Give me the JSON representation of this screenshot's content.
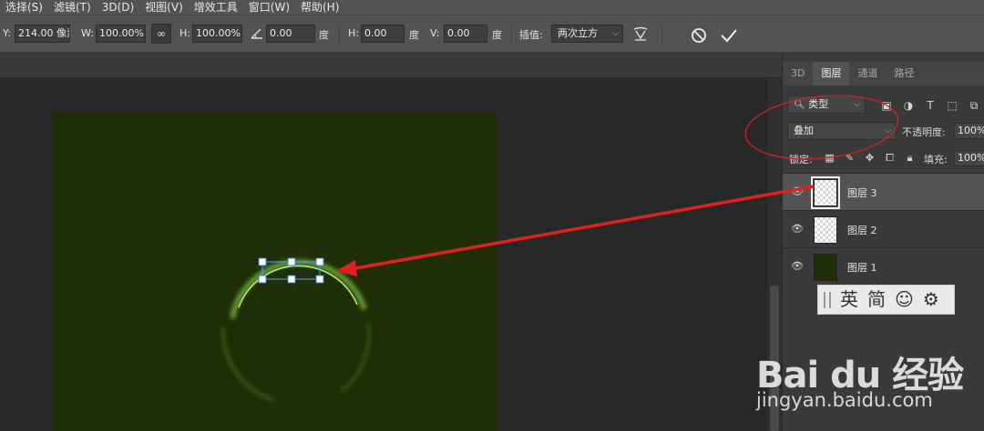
{
  "menu": [
    "选择(S)",
    "滤镜(T)",
    "3D(D)",
    "视图(V)",
    "增效工具",
    "窗口(W)",
    "帮助(H)"
  ],
  "options": {
    "y_label": "Y:",
    "y_value": "214.00 像素",
    "w_label": "W:",
    "w_value": "100.00%",
    "link_glyph": "∞",
    "h_label": "H:",
    "h_value": "100.00%",
    "angle_value": "0.00",
    "angle_unit": "度",
    "skew_h_label": "H:",
    "skew_h_value": "0.00",
    "skew_h_unit": "度",
    "skew_v_label": "V:",
    "skew_v_value": "0.00",
    "skew_v_unit": "度",
    "interp_label": "插值:",
    "interp_value": "两次立方"
  },
  "panel": {
    "tabs": [
      "3D",
      "图层",
      "通道",
      "路径"
    ],
    "active_tab": "图层",
    "filter_kind": "类型",
    "blend_mode": "叠加",
    "opacity_label": "不透明度:",
    "opacity_value": "100%",
    "lock_label": "锁定:",
    "fill_label": "填充:",
    "fill_value": "100%",
    "layers": [
      {
        "name": "图层 3",
        "selected": true
      },
      {
        "name": "图层 2",
        "selected": false
      },
      {
        "name": "图层 1",
        "selected": false
      }
    ]
  },
  "ime": {
    "lang": "英",
    "mode": "简"
  },
  "watermark": {
    "logo": "Bai du 经验",
    "url": "jingyan.baidu.com"
  },
  "colors": {
    "canvas": "#1f2e07",
    "annotation": "#e02020",
    "glow": "#8fd14f"
  }
}
